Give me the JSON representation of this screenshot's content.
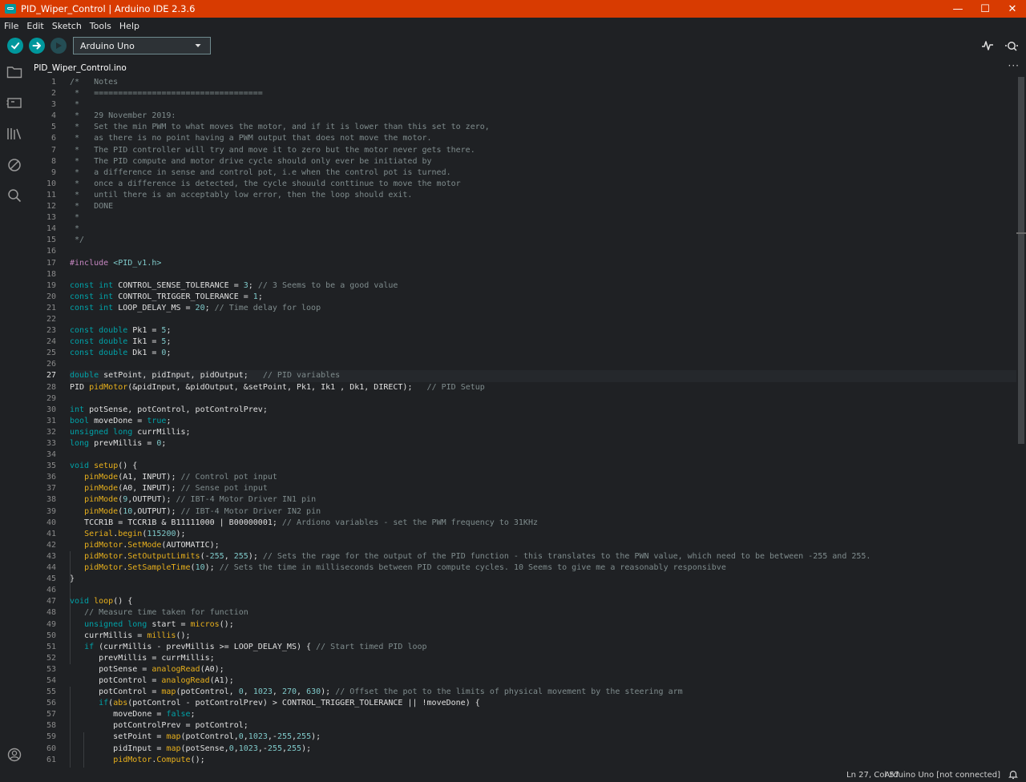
{
  "window": {
    "title": "PID_Wiper_Control | Arduino IDE 2.3.6",
    "controls": {
      "minimize": "—",
      "maximize": "☐",
      "close": "✕"
    }
  },
  "menu": [
    "File",
    "Edit",
    "Sketch",
    "Tools",
    "Help"
  ],
  "toolbar": {
    "board": "Arduino Uno",
    "icons": [
      "verify-icon",
      "upload-icon",
      "debug-icon",
      "serial-plotter-icon",
      "serial-monitor-icon"
    ]
  },
  "activity_icons": [
    "folder-icon",
    "boards-manager-icon",
    "library-icon",
    "debug-off-icon",
    "search-icon",
    "account-icon"
  ],
  "tab": {
    "label": "PID_Wiper_Control.ino",
    "more": "···"
  },
  "editor": {
    "current_line": 27,
    "lines": [
      [
        [
          "cm",
          "/*   Notes"
        ]
      ],
      [
        [
          "cm",
          " *   ==================================="
        ]
      ],
      [
        [
          "cm",
          " *"
        ]
      ],
      [
        [
          "cm",
          " *   29 November 2019:"
        ]
      ],
      [
        [
          "cm",
          " *   Set the min PWM to what moves the motor, and if it is lower than this set to zero,"
        ]
      ],
      [
        [
          "cm",
          " *   as there is no point having a PWM output that does not move the motor."
        ]
      ],
      [
        [
          "cm",
          " *   The PID controller will try and move it to zero but the motor never gets there."
        ]
      ],
      [
        [
          "cm",
          " *   The PID compute and motor drive cycle should only ever be initiated by"
        ]
      ],
      [
        [
          "cm",
          " *   a difference in sense and control pot, i.e when the control pot is turned."
        ]
      ],
      [
        [
          "cm",
          " *   once a difference is detected, the cycle shouuld conttinue to move the motor"
        ]
      ],
      [
        [
          "cm",
          " *   until there is an acceptably low error, then the loop should exit."
        ]
      ],
      [
        [
          "cm",
          " *   DONE"
        ]
      ],
      [
        [
          "cm",
          " *"
        ]
      ],
      [
        [
          "cm",
          " *"
        ]
      ],
      [
        [
          "cm",
          " */"
        ]
      ],
      [
        [
          "df",
          ""
        ]
      ],
      [
        [
          "pp",
          "#include "
        ],
        [
          "inc",
          "<PID_v1.h>"
        ]
      ],
      [
        [
          "df",
          ""
        ]
      ],
      [
        [
          "kw",
          "const int "
        ],
        [
          "df",
          "CONTROL_SENSE_TOLERANCE = "
        ],
        [
          "num",
          "3"
        ],
        [
          "df",
          "; "
        ],
        [
          "cm",
          "// 3 Seems to be a good value"
        ]
      ],
      [
        [
          "kw",
          "const int "
        ],
        [
          "df",
          "CONTROL_TRIGGER_TOLERANCE = "
        ],
        [
          "num",
          "1"
        ],
        [
          "df",
          ";"
        ]
      ],
      [
        [
          "kw",
          "const int "
        ],
        [
          "df",
          "LOOP_DELAY_MS = "
        ],
        [
          "num",
          "20"
        ],
        [
          "df",
          "; "
        ],
        [
          "cm",
          "// Time delay for loop"
        ]
      ],
      [
        [
          "df",
          ""
        ]
      ],
      [
        [
          "kw",
          "const double "
        ],
        [
          "df",
          "Pk1 = "
        ],
        [
          "num",
          "5"
        ],
        [
          "df",
          ";"
        ]
      ],
      [
        [
          "kw",
          "const double "
        ],
        [
          "df",
          "Ik1 = "
        ],
        [
          "num",
          "5"
        ],
        [
          "df",
          ";"
        ]
      ],
      [
        [
          "kw",
          "const double "
        ],
        [
          "df",
          "Dk1 = "
        ],
        [
          "num",
          "0"
        ],
        [
          "df",
          ";"
        ]
      ],
      [
        [
          "df",
          ""
        ]
      ],
      [
        [
          "kw",
          "double "
        ],
        [
          "df",
          "setPoint, pidInput, pidOutput;   "
        ],
        [
          "cm",
          "// PID variables"
        ]
      ],
      [
        [
          "df",
          "PID "
        ],
        [
          "fn",
          "pidMotor"
        ],
        [
          "df",
          "(&pidInput, &pidOutput, &setPoint, Pk1, Ik1 , Dk1, DIRECT);   "
        ],
        [
          "cm",
          "// PID Setup"
        ]
      ],
      [
        [
          "df",
          ""
        ]
      ],
      [
        [
          "kw",
          "int "
        ],
        [
          "df",
          "potSense, potControl, potControlPrev;"
        ]
      ],
      [
        [
          "kw",
          "bool "
        ],
        [
          "df",
          "moveDone = "
        ],
        [
          "kw",
          "true"
        ],
        [
          "df",
          ";"
        ]
      ],
      [
        [
          "kw",
          "unsigned long "
        ],
        [
          "df",
          "currMillis;"
        ]
      ],
      [
        [
          "kw",
          "long "
        ],
        [
          "df",
          "prevMillis = "
        ],
        [
          "num",
          "0"
        ],
        [
          "df",
          ";"
        ]
      ],
      [
        [
          "df",
          ""
        ]
      ],
      [
        [
          "kw",
          "void "
        ],
        [
          "fn",
          "setup"
        ],
        [
          "df",
          "() {"
        ]
      ],
      [
        [
          "df",
          "   "
        ],
        [
          "fn",
          "pinMode"
        ],
        [
          "df",
          "(A1, INPUT); "
        ],
        [
          "cm",
          "// Control pot input"
        ]
      ],
      [
        [
          "df",
          "   "
        ],
        [
          "fn",
          "pinMode"
        ],
        [
          "df",
          "(A0, INPUT); "
        ],
        [
          "cm",
          "// Sense pot input"
        ]
      ],
      [
        [
          "df",
          "   "
        ],
        [
          "fn",
          "pinMode"
        ],
        [
          "df",
          "("
        ],
        [
          "num",
          "9"
        ],
        [
          "df",
          ",OUTPUT); "
        ],
        [
          "cm",
          "// IBT-4 Motor Driver IN1 pin"
        ]
      ],
      [
        [
          "df",
          "   "
        ],
        [
          "fn",
          "pinMode"
        ],
        [
          "df",
          "("
        ],
        [
          "num",
          "10"
        ],
        [
          "df",
          ",OUTPUT); "
        ],
        [
          "cm",
          "// IBT-4 Motor Driver IN2 pin"
        ]
      ],
      [
        [
          "df",
          "   TCCR1B = TCCR1B & B11111000 | B00000001; "
        ],
        [
          "cm",
          "// Ardiono variables - set the PWM frequency to 31KHz"
        ]
      ],
      [
        [
          "df",
          "   "
        ],
        [
          "fn",
          "Serial"
        ],
        [
          "df",
          "."
        ],
        [
          "fn",
          "begin"
        ],
        [
          "df",
          "("
        ],
        [
          "num",
          "115200"
        ],
        [
          "df",
          ");"
        ]
      ],
      [
        [
          "df",
          "   "
        ],
        [
          "fn",
          "pidMotor"
        ],
        [
          "df",
          "."
        ],
        [
          "fn",
          "SetMode"
        ],
        [
          "df",
          "(AUTOMATIC);"
        ]
      ],
      [
        [
          "df",
          "   "
        ],
        [
          "fn",
          "pidMotor"
        ],
        [
          "df",
          "."
        ],
        [
          "fn",
          "SetOutputLimits"
        ],
        [
          "df",
          "(-"
        ],
        [
          "num",
          "255"
        ],
        [
          "df",
          ", "
        ],
        [
          "num",
          "255"
        ],
        [
          "df",
          "); "
        ],
        [
          "cm",
          "// Sets the rage for the output of the PID function - this translates to the PWN value, which need to be between -255 and 255."
        ]
      ],
      [
        [
          "df",
          "   "
        ],
        [
          "fn",
          "pidMotor"
        ],
        [
          "df",
          "."
        ],
        [
          "fn",
          "SetSampleTime"
        ],
        [
          "df",
          "("
        ],
        [
          "num",
          "10"
        ],
        [
          "df",
          "); "
        ],
        [
          "cm",
          "// Sets the time in milliseconds between PID compute cycles. 10 Seems to give me a reasonably responsibve"
        ]
      ],
      [
        [
          "df",
          "}"
        ]
      ],
      [
        [
          "df",
          ""
        ]
      ],
      [
        [
          "kw",
          "void "
        ],
        [
          "fn",
          "loop"
        ],
        [
          "df",
          "() {"
        ]
      ],
      [
        [
          "df",
          "   "
        ],
        [
          "cm",
          "// Measure time taken for function"
        ]
      ],
      [
        [
          "df",
          "   "
        ],
        [
          "kw",
          "unsigned long "
        ],
        [
          "df",
          "start = "
        ],
        [
          "fn",
          "micros"
        ],
        [
          "df",
          "();"
        ]
      ],
      [
        [
          "df",
          "   currMillis = "
        ],
        [
          "fn",
          "millis"
        ],
        [
          "df",
          "();"
        ]
      ],
      [
        [
          "df",
          "   "
        ],
        [
          "kw",
          "if "
        ],
        [
          "df",
          "(currMillis - prevMillis >= LOOP_DELAY_MS) { "
        ],
        [
          "cm",
          "// Start timed PID loop"
        ]
      ],
      [
        [
          "df",
          "      prevMillis = currMillis;"
        ]
      ],
      [
        [
          "df",
          "      potSense = "
        ],
        [
          "fn",
          "analogRead"
        ],
        [
          "df",
          "(A0);"
        ]
      ],
      [
        [
          "df",
          "      potControl = "
        ],
        [
          "fn",
          "analogRead"
        ],
        [
          "df",
          "(A1);"
        ]
      ],
      [
        [
          "df",
          "      potControl = "
        ],
        [
          "fn",
          "map"
        ],
        [
          "df",
          "(potControl, "
        ],
        [
          "num",
          "0"
        ],
        [
          "df",
          ", "
        ],
        [
          "num",
          "1023"
        ],
        [
          "df",
          ", "
        ],
        [
          "num",
          "270"
        ],
        [
          "df",
          ", "
        ],
        [
          "num",
          "630"
        ],
        [
          "df",
          "); "
        ],
        [
          "cm",
          "// Offset the pot to the limits of physical movement by the steering arm"
        ]
      ],
      [
        [
          "df",
          "      "
        ],
        [
          "kw",
          "if"
        ],
        [
          "df",
          "("
        ],
        [
          "fn",
          "abs"
        ],
        [
          "df",
          "(potControl - potControlPrev) > CONTROL_TRIGGER_TOLERANCE || !moveDone) {"
        ]
      ],
      [
        [
          "df",
          "         moveDone = "
        ],
        [
          "kw",
          "false"
        ],
        [
          "df",
          ";"
        ]
      ],
      [
        [
          "df",
          "         potControlPrev = potControl;"
        ]
      ],
      [
        [
          "df",
          "         setPoint = "
        ],
        [
          "fn",
          "map"
        ],
        [
          "df",
          "(potControl,"
        ],
        [
          "num",
          "0"
        ],
        [
          "df",
          ","
        ],
        [
          "num",
          "1023"
        ],
        [
          "df",
          ",-"
        ],
        [
          "num",
          "255"
        ],
        [
          "df",
          ","
        ],
        [
          "num",
          "255"
        ],
        [
          "df",
          ");"
        ]
      ],
      [
        [
          "df",
          "         pidInput = "
        ],
        [
          "fn",
          "map"
        ],
        [
          "df",
          "(potSense,"
        ],
        [
          "num",
          "0"
        ],
        [
          "df",
          ","
        ],
        [
          "num",
          "1023"
        ],
        [
          "df",
          ",-"
        ],
        [
          "num",
          "255"
        ],
        [
          "df",
          ","
        ],
        [
          "num",
          "255"
        ],
        [
          "df",
          ");"
        ]
      ],
      [
        [
          "df",
          "         "
        ],
        [
          "fn",
          "pidMotor"
        ],
        [
          "df",
          "."
        ],
        [
          "fn",
          "Compute"
        ],
        [
          "df",
          "();"
        ]
      ]
    ]
  },
  "status": {
    "position": "Ln 27, Col 57",
    "board": "Arduino Uno [not connected]"
  }
}
